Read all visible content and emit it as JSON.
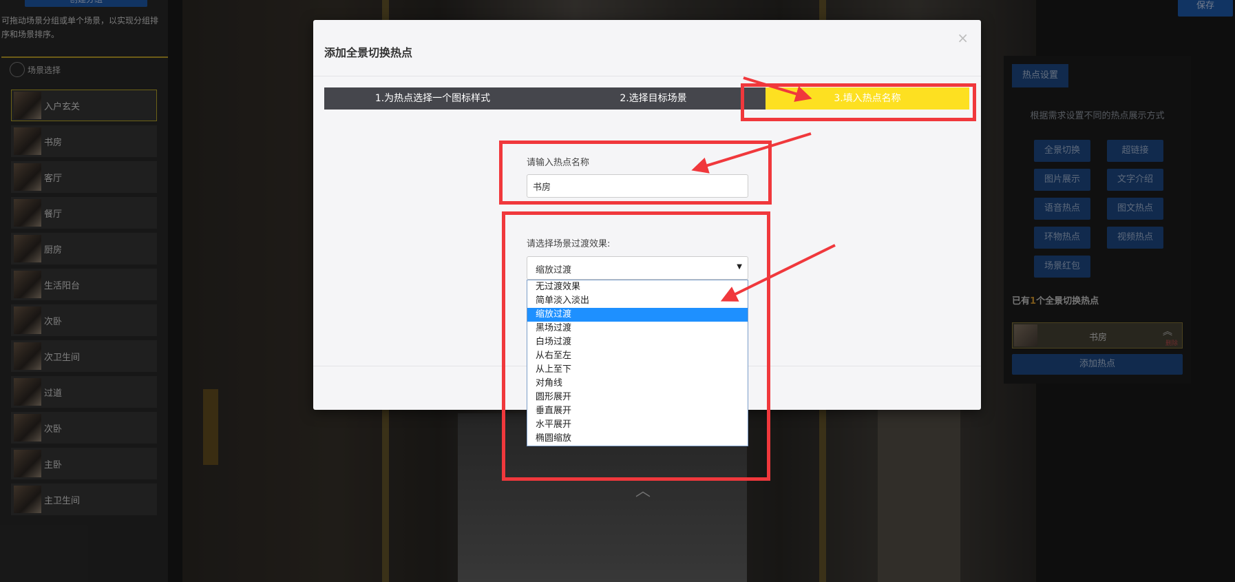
{
  "background": {
    "left_panel": {
      "top_button": "创建分组",
      "hint": "可拖动场景分组或单个场景，以实现分组排序和场景排序。",
      "section_title": "场景选择",
      "scenes": [
        {
          "name": "入户玄关",
          "active": true
        },
        {
          "name": "书房",
          "active": false
        },
        {
          "name": "客厅",
          "active": false
        },
        {
          "name": "餐厅",
          "active": false
        },
        {
          "name": "厨房",
          "active": false
        },
        {
          "name": "生活阳台",
          "active": false
        },
        {
          "name": "次卧",
          "active": false
        },
        {
          "name": "次卫生间",
          "active": false
        },
        {
          "name": "过道",
          "active": false
        },
        {
          "name": "次卧",
          "active": false
        },
        {
          "name": "主卧",
          "active": false
        },
        {
          "name": "主卫生间",
          "active": false
        }
      ]
    },
    "save_label": "保存",
    "right_panel": {
      "tab": "热点设置",
      "desc": "根据需求设置不同的热点展示方式",
      "buttons": [
        "全景切换",
        "超链接",
        "图片展示",
        "文字介绍",
        "语音热点",
        "图文热点",
        "环物热点",
        "视频热点",
        "场景红包"
      ],
      "count_prefix": "已有",
      "count_value": "1",
      "count_suffix": "个全景切换热点",
      "hotspot_name": "书房",
      "hotspot_delete": "删除",
      "add_label": "添加热点"
    }
  },
  "modal": {
    "title": "添加全景切换热点",
    "close": "×",
    "steps": [
      "1.为热点选择一个图标样式",
      "2.选择目标场景",
      "3.填入热点名称"
    ],
    "name_label": "请输入热点名称",
    "name_value": "书房",
    "transition_label": "请选择场景过渡效果:",
    "transition_selected": "缩放过渡",
    "transition_options": [
      "无过渡效果",
      "简单淡入淡出",
      "缩放过渡",
      "黑场过渡",
      "白场过渡",
      "从右至左",
      "从上至下",
      "对角线",
      "圆形展开",
      "垂直展开",
      "水平展开",
      "椭圆缩放"
    ],
    "selected_index": 2
  },
  "colors": {
    "active_step": "#fde021",
    "annotation": "#f0383c",
    "selected_option": "#1e90ff"
  }
}
